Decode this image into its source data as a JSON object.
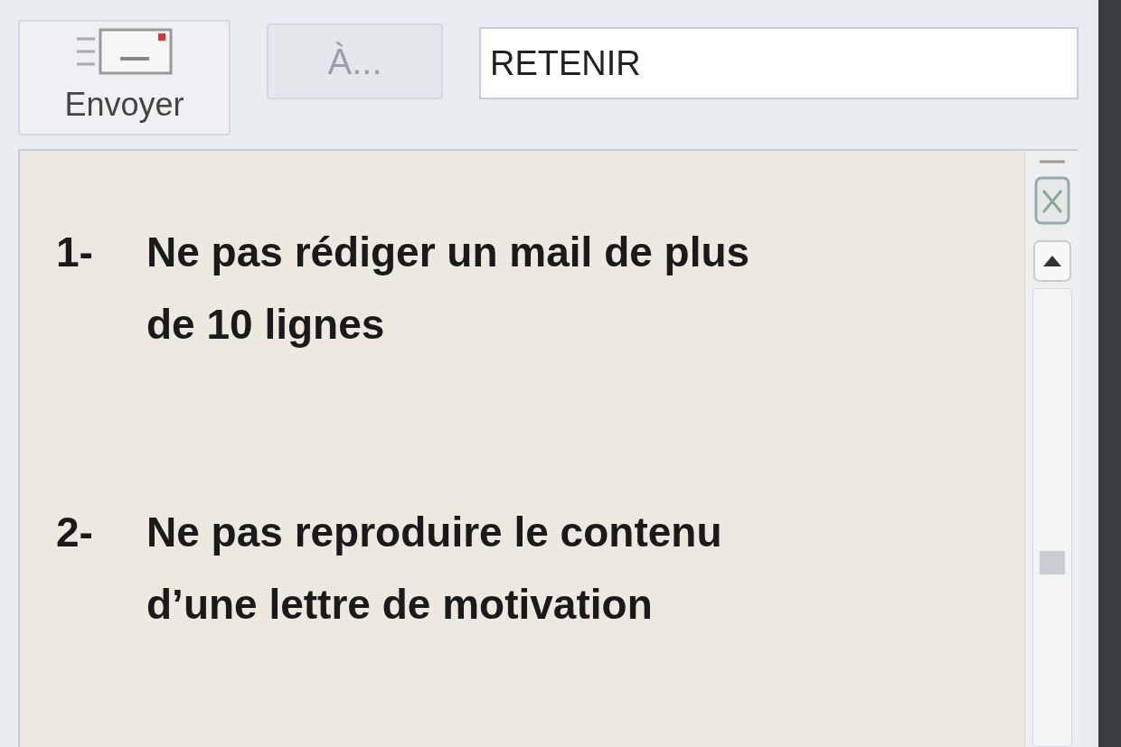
{
  "toolbar": {
    "send_button": "Envoyer",
    "to_button": "À...",
    "subject_field": {
      "value": "RETENIR"
    }
  },
  "body": {
    "items": [
      {
        "number": "1-",
        "text": "Ne pas rédiger un mail de plus de 10 lignes"
      },
      {
        "number": "2-",
        "text": "Ne pas reproduire le contenu d’une lettre de motivation"
      }
    ]
  }
}
